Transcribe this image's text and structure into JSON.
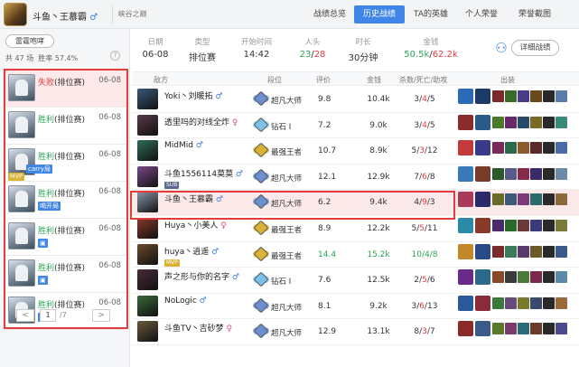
{
  "user": {
    "name": "斗鱼丶王慕霸",
    "sex_icon": "male-icon",
    "sex": "♂",
    "server": "峡谷之巅"
  },
  "nav": {
    "tabs": [
      "战绩总览",
      "历史战绩",
      "TA的英雄",
      "个人荣誉",
      "荣誉截图"
    ],
    "active": 1
  },
  "sidebar": {
    "mode_button": "雷霆咆哮",
    "total_label": "共 47 场",
    "winrate_label": "胜率 57.4%",
    "help_icon": "?",
    "matches": [
      {
        "result": "失败",
        "type": "(排位赛)",
        "date": "06-08",
        "win": false,
        "selected": true,
        "badge": "",
        "tag": ""
      },
      {
        "result": "胜利",
        "type": "(排位赛)",
        "date": "06-08",
        "win": true,
        "selected": false,
        "badge": "",
        "tag": ""
      },
      {
        "result": "胜利",
        "type": "(排位赛)",
        "date": "06-08",
        "win": true,
        "selected": false,
        "badge": "MVP",
        "tag": "carry局"
      },
      {
        "result": "胜利",
        "type": "(排位赛)",
        "date": "06-08",
        "win": true,
        "selected": false,
        "badge": "",
        "tag": "喝开局"
      },
      {
        "result": "胜利",
        "type": "(排位赛)",
        "date": "06-08",
        "win": true,
        "selected": false,
        "badge": "",
        "tag": "▣"
      },
      {
        "result": "胜利",
        "type": "(排位赛)",
        "date": "06-08",
        "win": true,
        "selected": false,
        "badge": "",
        "tag": "▣"
      },
      {
        "result": "胜利",
        "type": "(排位赛)",
        "date": "06-08",
        "win": true,
        "selected": false,
        "badge": "",
        "tag": "▣"
      }
    ],
    "pager": {
      "prev": "<",
      "current": "1",
      "total": "/7",
      "next": ">"
    }
  },
  "match_header": {
    "fields": [
      {
        "label": "日期",
        "value": "06-08"
      },
      {
        "label": "类型",
        "value": "排位赛"
      },
      {
        "label": "开始时间",
        "value": "14:42"
      },
      {
        "label": "人头",
        "value_win": "23",
        "value_loss": "28"
      },
      {
        "label": "时长",
        "value": "30分钟"
      },
      {
        "label": "金钱",
        "value_win": "50.5k",
        "value_loss": "62.2k"
      }
    ],
    "detail_button": "详细战绩"
  },
  "table": {
    "headers": [
      "敌方",
      "段位",
      "评价",
      "金钱",
      "杀数/死亡/助攻",
      "出装"
    ],
    "rows": [
      {
        "name": "Yoki丶刘暖拓",
        "sex": "♂",
        "rank": "超凡大师",
        "score": "9.8",
        "gold": "10.4k",
        "k": "3",
        "d": "4",
        "a": "5",
        "rank_color": "#6c8fd0",
        "av": "#3a5a7a",
        "sub": []
      },
      {
        "name": "透里吗的对线全炸",
        "sex": "♀",
        "rank": "钻石 Ⅰ",
        "score": "7.2",
        "gold": "9.0k",
        "k": "3",
        "d": "4",
        "a": "5",
        "rank_color": "#7fc0e8",
        "av": "#5a3a4a",
        "sub": []
      },
      {
        "name": "MidMid",
        "sex": "♂",
        "rank": "最强王者",
        "score": "10.7",
        "gold": "8.9k",
        "k": "5",
        "d": "3",
        "a": "12",
        "rank_color": "#d9b236",
        "av": "#2e6e5a",
        "sub": []
      },
      {
        "name": "斗鱼1556114莫莫",
        "sex": "♂",
        "rank": "超凡大师",
        "score": "12.1",
        "gold": "12.9k",
        "k": "7",
        "d": "6",
        "a": "8",
        "rank_color": "#6c8fd0",
        "av": "#7a4a8a",
        "sub": [
          "SUB"
        ]
      },
      {
        "name": "斗鱼丶王慕霸",
        "sex": "♂",
        "rank": "超凡大师",
        "score": "6.2",
        "gold": "9.4k",
        "k": "4",
        "d": "9",
        "a": "3",
        "rank_color": "#6c8fd0",
        "av": "#8a98a8",
        "sub": [],
        "hl": true
      },
      {
        "name": "Huya丶小美人",
        "sex": "♀",
        "rank": "最强王者",
        "score": "8.9",
        "gold": "12.2k",
        "k": "5",
        "d": "5",
        "a": "11",
        "rank_color": "#d9b236",
        "av": "#8a3a2a",
        "sub": []
      },
      {
        "name": "huya丶逍遥",
        "sex": "♂",
        "rank": "最强王者",
        "score": "14.4",
        "gold": "15.2k",
        "k": "10",
        "d": "4",
        "a": "8",
        "rank_color": "#d9b236",
        "av": "#6a4a2a",
        "sub": [
          "MVP"
        ],
        "good": true
      },
      {
        "name": "声之形与你的名字",
        "sex": "♂",
        "rank": "钻石 Ⅰ",
        "score": "7.6",
        "gold": "12.5k",
        "k": "2",
        "d": "5",
        "a": "6",
        "rank_color": "#7fc0e8",
        "av": "#4a2a3a",
        "sub": []
      },
      {
        "name": "NoLogic",
        "sex": "♂",
        "rank": "超凡大师",
        "score": "8.1",
        "gold": "9.2k",
        "k": "3",
        "d": "6",
        "a": "13",
        "rank_color": "#6c8fd0",
        "av": "#3a6a3a",
        "sub": []
      },
      {
        "name": "斗鱼TV丶吉砂梦",
        "sex": "♀",
        "rank": "超凡大师",
        "score": "12.9",
        "gold": "13.1k",
        "k": "8",
        "d": "3",
        "a": "7",
        "rank_color": "#6c8fd0",
        "av": "#6a5a3a",
        "sub": []
      }
    ]
  },
  "colors": {
    "accent": "#3f86e6",
    "win": "#2aa653",
    "loss": "#e23c3c"
  }
}
